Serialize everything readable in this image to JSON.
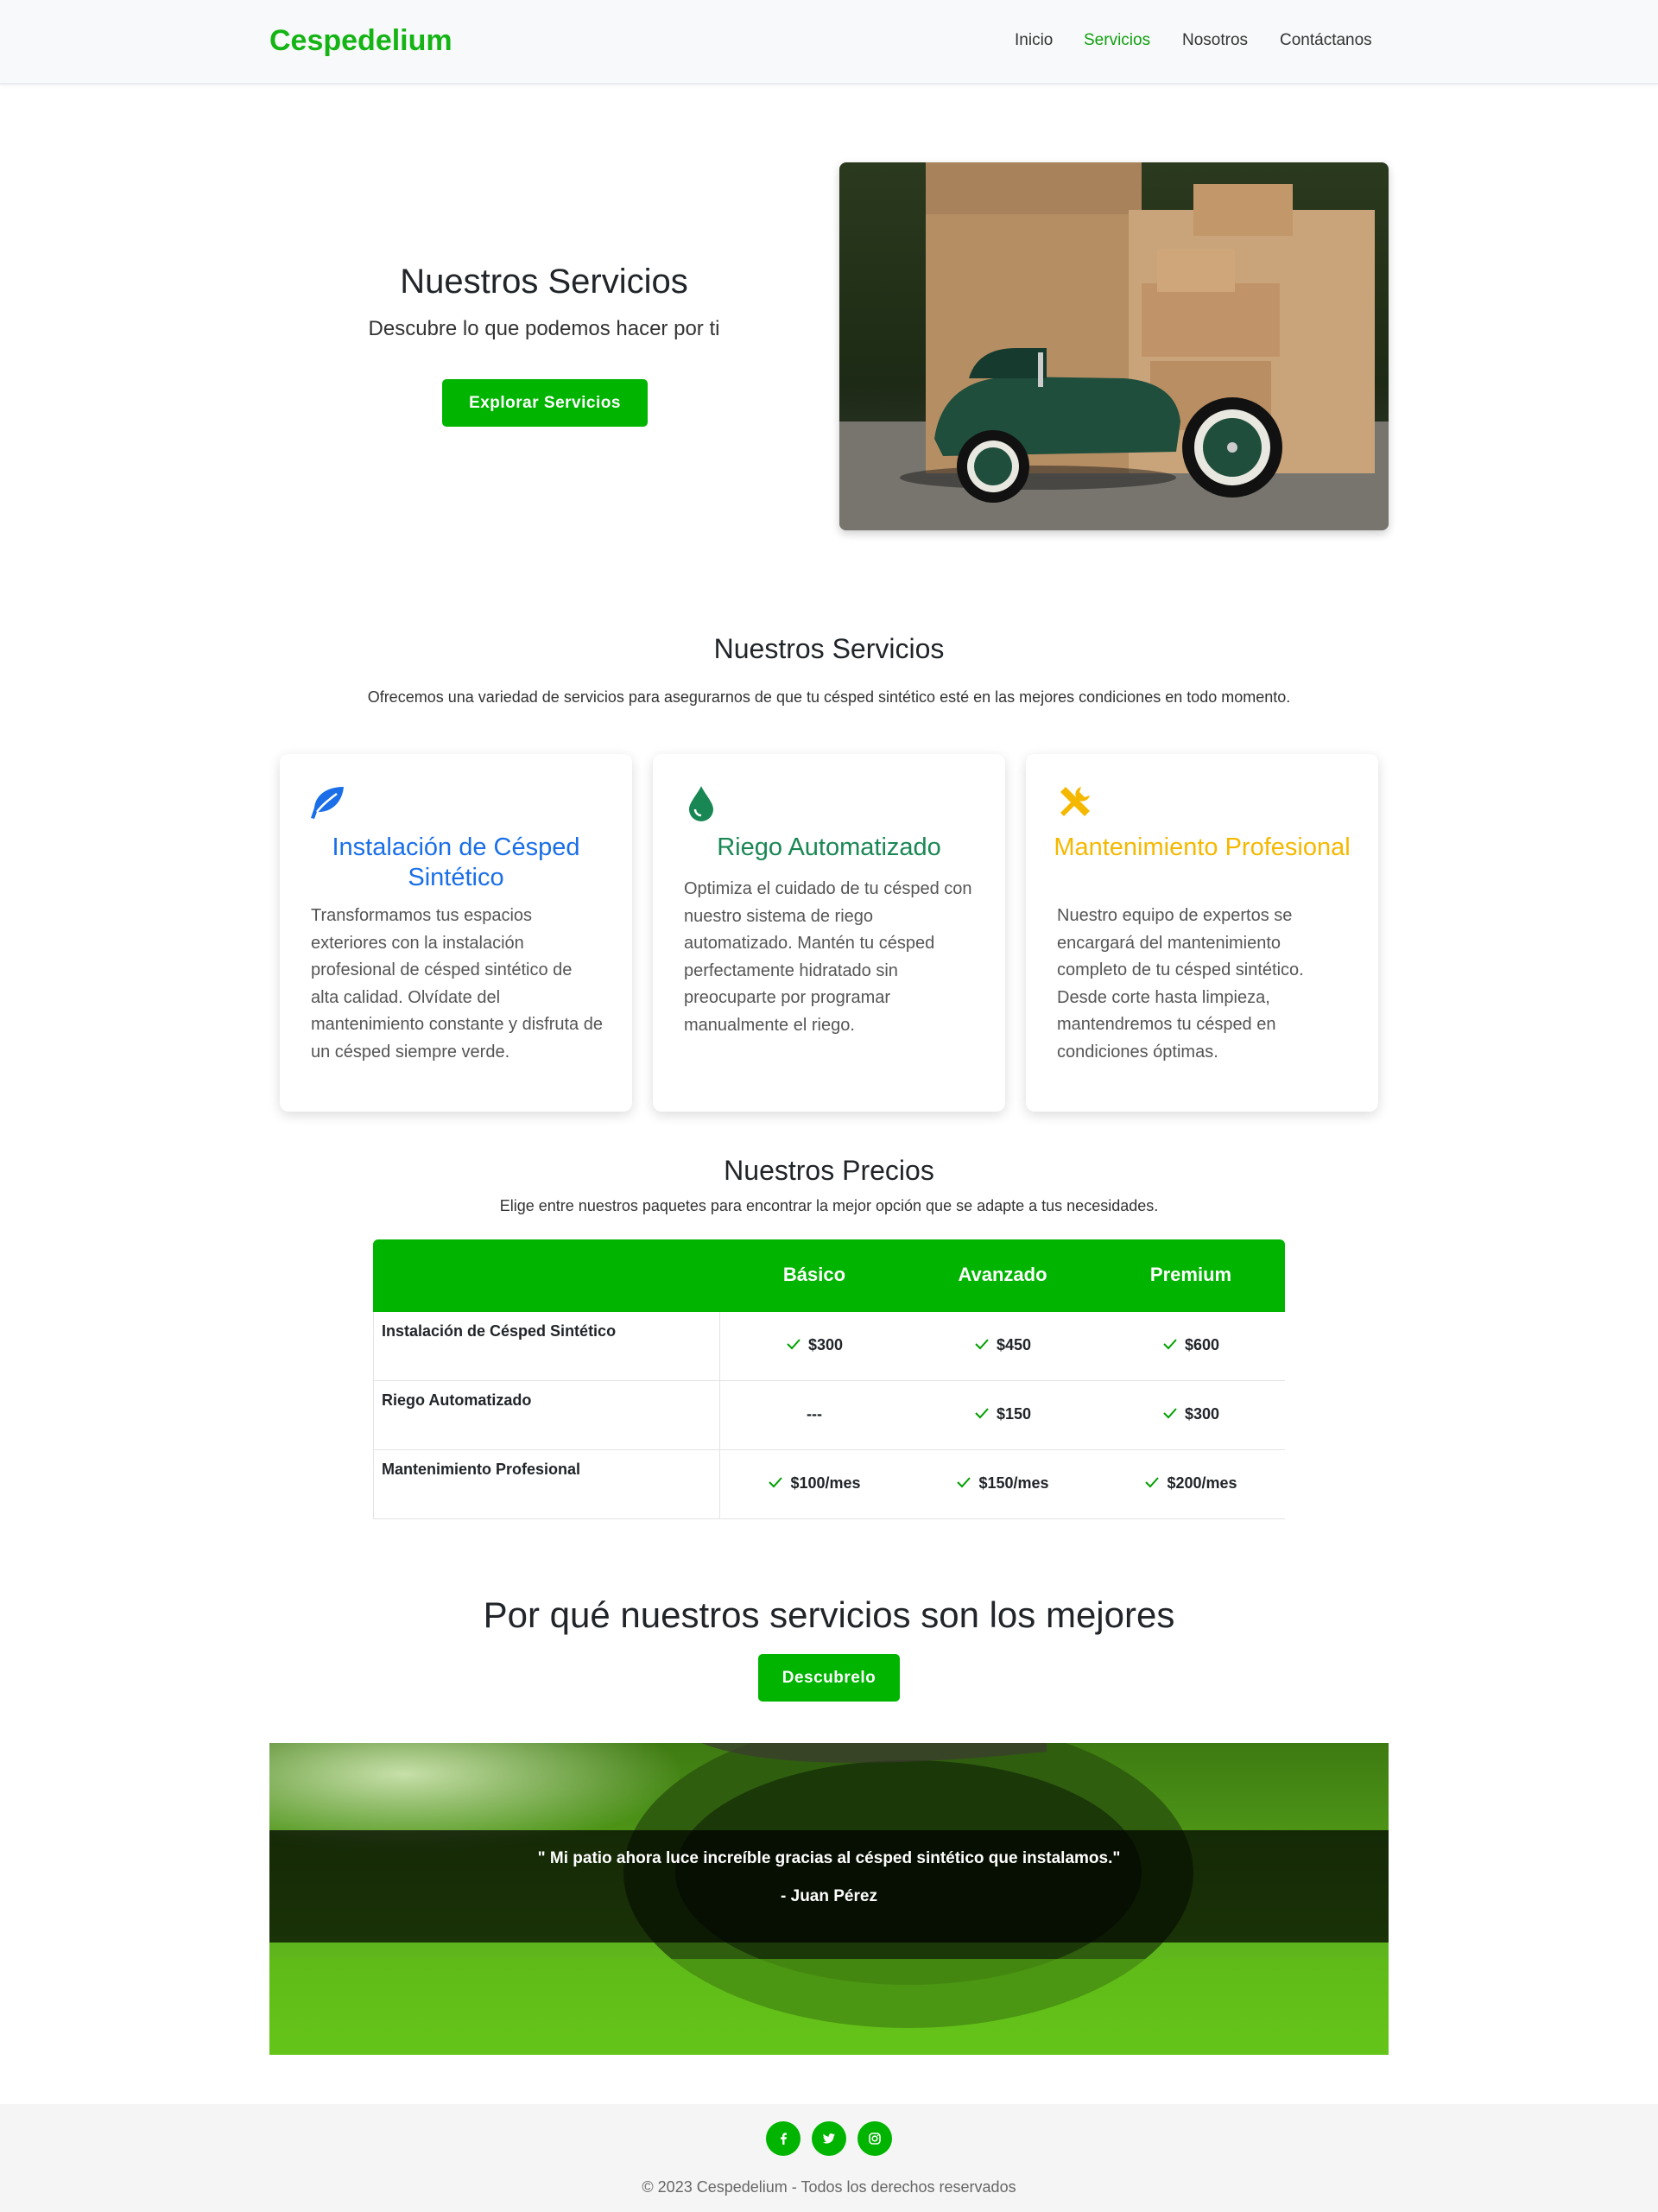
{
  "nav": {
    "brand": "Cespedelium",
    "links": [
      "Inicio",
      "Servicios",
      "Nosotros",
      "Contáctanos"
    ],
    "active": "Servicios"
  },
  "hero": {
    "title": "Nuestros Servicios",
    "subtitle": "Descubre lo que podemos hacer por ti",
    "button": "Explorar Servicios",
    "image": "toy-car-with-boxes-photo"
  },
  "services": {
    "title": "Nuestros Servicios",
    "subtitle": "Ofrecemos una variedad de servicios para asegurarnos de que tu césped sintético esté en las mejores condiciones en todo momento.",
    "cards": [
      {
        "icon": "leaf-icon",
        "color": "#1a6fe8",
        "title": "Instalación de Césped Sintético",
        "text": "Transformamos tus espacios exteriores con la instalación profesional de césped sintético de alta calidad. Olvídate del mantenimiento constante y disfruta de un césped siempre verde."
      },
      {
        "icon": "droplet-icon",
        "color": "#198754",
        "title": "Riego Automatizado",
        "text": "Optimiza el cuidado de tu césped con nuestro sistema de riego automatizado. Mantén tu césped perfectamente hidratado sin preocuparte por programar manualmente el riego."
      },
      {
        "icon": "tools-icon",
        "color": "#f5b800",
        "title": "Mantenimiento Profesional",
        "text": "Nuestro equipo de expertos se encargará del mantenimiento completo de tu césped sintético. Desde corte hasta limpieza, mantendremos tu césped en condiciones óptimas."
      }
    ]
  },
  "pricing": {
    "title": "Nuestros Precios",
    "subtitle": "Elige entre nuestros paquetes para encontrar la mejor opción que se adapte a tus necesidades.",
    "plans": [
      "Básico",
      "Avanzado",
      "Premium"
    ],
    "rows": [
      {
        "label": "Instalación de Césped Sintético",
        "values": [
          "$300",
          "$450",
          "$600"
        ],
        "checks": [
          true,
          true,
          true
        ]
      },
      {
        "label": "Riego Automatizado",
        "values": [
          "---",
          "$150",
          "$300"
        ],
        "checks": [
          false,
          true,
          true
        ]
      },
      {
        "label": "Mantenimiento Profesional",
        "values": [
          "$100/mes",
          "$150/mes",
          "$200/mes"
        ],
        "checks": [
          true,
          true,
          true
        ]
      }
    ]
  },
  "why": {
    "title": "Por qué nuestros servicios son los mejores",
    "button": "Descubrelo"
  },
  "testimonial": {
    "quote": "\" Mi patio ahora luce increíble gracias al césped sintético que instalamos.\"",
    "author": "- Juan Pérez",
    "image": "rolled-artificial-grass-photo"
  },
  "footer": {
    "social": [
      "facebook-icon",
      "twitter-icon",
      "instagram-icon"
    ],
    "copyright": "© 2023 Cespedelium - Todos los derechos reservados"
  },
  "colors": {
    "accent": "#00b400",
    "brand": "#14b414"
  }
}
